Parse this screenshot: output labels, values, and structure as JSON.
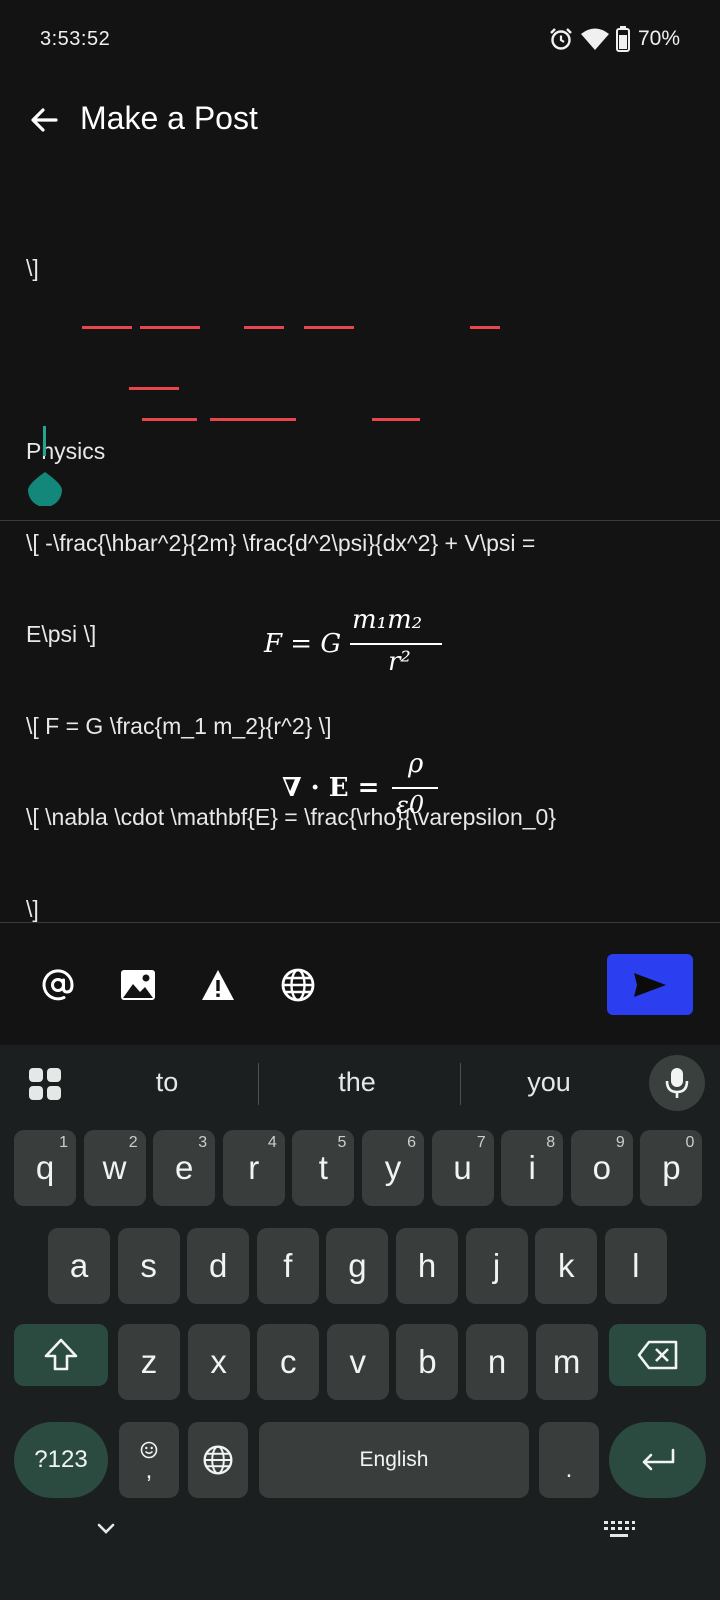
{
  "status_bar": {
    "time": "3:53:52",
    "battery": "70%",
    "icons": [
      "alarm-icon",
      "wifi-icon",
      "battery-icon"
    ]
  },
  "header": {
    "title": "Make a Post",
    "back_icon": "arrow-left-icon"
  },
  "editor": {
    "lines": [
      "\\]",
      "",
      "Physics",
      "\\[ -\\frac{\\hbar^2}{2m} \\frac{d^2\\psi}{dx^2} + V\\psi =",
      "E\\psi \\]",
      "\\[ F = G \\frac{m_1 m_2}{r^2} \\]",
      "\\[ \\nabla \\cdot \\mathbf{E} = \\frac{\\rho}{\\varepsilon_0}",
      "\\]"
    ]
  },
  "preview": {
    "equations": [
      {
        "lhs": "F = G",
        "num": "m₁m₂",
        "den": "r²"
      },
      {
        "lhs": "∇ · E =",
        "num": "ρ",
        "den": "ε0"
      }
    ]
  },
  "toolbar": {
    "icons": [
      "at-mention-icon",
      "image-icon",
      "warning-icon",
      "globe-icon"
    ],
    "send_icon": "send-icon",
    "accent": "#2b3ff0"
  },
  "keyboard": {
    "suggestions": [
      "to",
      "the",
      "you"
    ],
    "row1": [
      {
        "k": "q",
        "h": "1"
      },
      {
        "k": "w",
        "h": "2"
      },
      {
        "k": "e",
        "h": "3"
      },
      {
        "k": "r",
        "h": "4"
      },
      {
        "k": "t",
        "h": "5"
      },
      {
        "k": "y",
        "h": "6"
      },
      {
        "k": "u",
        "h": "7"
      },
      {
        "k": "i",
        "h": "8"
      },
      {
        "k": "o",
        "h": "9"
      },
      {
        "k": "p",
        "h": "0"
      }
    ],
    "row2": [
      "a",
      "s",
      "d",
      "f",
      "g",
      "h",
      "j",
      "k",
      "l"
    ],
    "row3": [
      "z",
      "x",
      "c",
      "v",
      "b",
      "n",
      "m"
    ],
    "symbols_label": "?123",
    "comma_label": ",",
    "space_label": "English",
    "period_label": "."
  }
}
